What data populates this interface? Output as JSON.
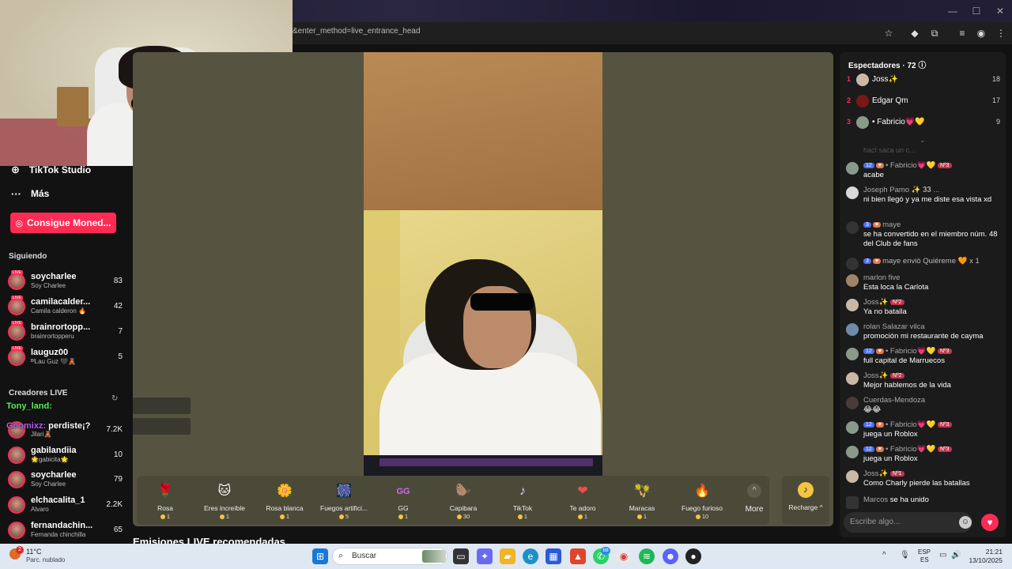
{
  "browser": {
    "url": "&enter_method=live_entrance_head"
  },
  "sidebar": {
    "studio_label": "TikTok Studio",
    "more_label": "Más",
    "coins_button": "Consigue Moned...",
    "following_title": "Siguiendo",
    "following": [
      {
        "name": "soycharlee",
        "sub": "Soy Charlee",
        "count": "83"
      },
      {
        "name": "camilacalder...",
        "sub": "Camila calderon 🔥",
        "count": "42"
      },
      {
        "name": "brainrortopp...",
        "sub": "brainrortopperu",
        "count": "7"
      },
      {
        "name": "lauguz00",
        "sub": "ᴮᴵLau Guz 🖤🧸",
        "count": "5"
      }
    ],
    "live_creators_title": "Creadores LIVE",
    "live_creators": [
      {
        "name": "",
        "sub": "Jilari🧸",
        "count": "7.2K"
      },
      {
        "name": "gabilandiia",
        "sub": "🌟gabicita🌟",
        "count": "10"
      },
      {
        "name": "soycharlee",
        "sub": "Soy Charlee",
        "count": "79"
      },
      {
        "name": "elchacalita_1",
        "sub": "Alvaro",
        "count": "2.2K"
      },
      {
        "name": "fernandachin...",
        "sub": "Fernanda chinchilla",
        "count": "65"
      }
    ]
  },
  "overlay": {
    "msg1": "Tony_land:",
    "msg2_user": "Goomixz:",
    "msg2_text": " perdiste¡?"
  },
  "gifts": [
    {
      "name": "Rosa",
      "price": "1",
      "icon": "🌹"
    },
    {
      "name": "Eres increíble",
      "price": "1",
      "icon": "🐱"
    },
    {
      "name": "Rosa blanca",
      "price": "1",
      "icon": "🌼"
    },
    {
      "name": "Fuegos artifici...",
      "price": "5",
      "icon": "🎆"
    },
    {
      "name": "GG",
      "price": "1",
      "icon": "GG"
    },
    {
      "name": "Capibara",
      "price": "30",
      "icon": "🦫"
    },
    {
      "name": "TikTok",
      "price": "1",
      "icon": "♪"
    },
    {
      "name": "Te adoro",
      "price": "1",
      "icon": "❤"
    },
    {
      "name": "Maracas",
      "price": "1",
      "icon": "🪇"
    },
    {
      "name": "Fuego furioso",
      "price": "10",
      "icon": "🔥"
    }
  ],
  "more_gifts_label": "More",
  "recharge_label": "Recharge ^",
  "recommended_title": "Emisiones LIVE recomendadas",
  "chat": {
    "viewers_title": "Espectadores · 72 ⓘ",
    "top_viewers": [
      {
        "rank": "1",
        "name": "Joss✨",
        "score": "18"
      },
      {
        "rank": "2",
        "name": "Edgar Qm",
        "score": "17"
      },
      {
        "rank": "3",
        "name": "• Fabricio💗💛",
        "score": "9"
      }
    ],
    "faded_line": "hacI saca un c...",
    "messages": [
      {
        "badges": [
          "12"
        ],
        "user": "• Fabricio💗💛",
        "extra": "Nº3",
        "text": "acabe"
      },
      {
        "badges": [],
        "user": "Joseph Pamo ✨ 𝟑𝟑 ...",
        "extra": "",
        "text": "ni bien llegó y ya me diste esa vista xd"
      },
      {
        "badges": [
          "3"
        ],
        "user": "maye",
        "extra": "",
        "text": "se ha convertido en el miembro núm. 48 del Club de fans"
      },
      {
        "badges": [
          "3"
        ],
        "user": "maye enviò Quiéreme 🧡 x 1",
        "extra": "",
        "text": ""
      },
      {
        "badges": [],
        "user": "marlon five",
        "extra": "",
        "text": "Esta loca la Carlota"
      },
      {
        "badges": [],
        "user": "Joss✨",
        "extra": "Nº2",
        "text": "Ya no batalla"
      },
      {
        "badges": [],
        "user": "rolan Salazar vilca",
        "extra": "",
        "text": "promoción mi restaurante de cayma"
      },
      {
        "badges": [
          "12"
        ],
        "user": "• Fabricio💗💛",
        "extra": "Nº3",
        "text": "full capital de Marruecos"
      },
      {
        "badges": [],
        "user": "Joss✨",
        "extra": "Nº2",
        "text": "Mejor hablemos de la vida"
      },
      {
        "badges": [],
        "user": "Cuerdas-Mendoza",
        "extra": "",
        "text": "😂😂"
      },
      {
        "badges": [
          "12"
        ],
        "user": "• Fabricio💗💛",
        "extra": "Nº3",
        "text": "juega un Roblox"
      },
      {
        "badges": [
          "12"
        ],
        "user": "• Fabricio💗💛",
        "extra": "Nº3",
        "text": "juega un Roblox"
      },
      {
        "badges": [],
        "user": "Joss✨",
        "extra": "Nº1",
        "text": "Como Charly pierde las batallas"
      }
    ],
    "joined_user": "Marcos",
    "joined_text": "se ha unido",
    "input_placeholder": "Escribe algo..."
  },
  "taskbar": {
    "weather_badge": "2",
    "temp": "11°C",
    "weather": "Parc. nublado",
    "search": "Buscar",
    "lang1": "ESP",
    "lang2": "ES",
    "time": "21:21",
    "date": "13/10/2025",
    "whatsapp_badge": "68"
  }
}
